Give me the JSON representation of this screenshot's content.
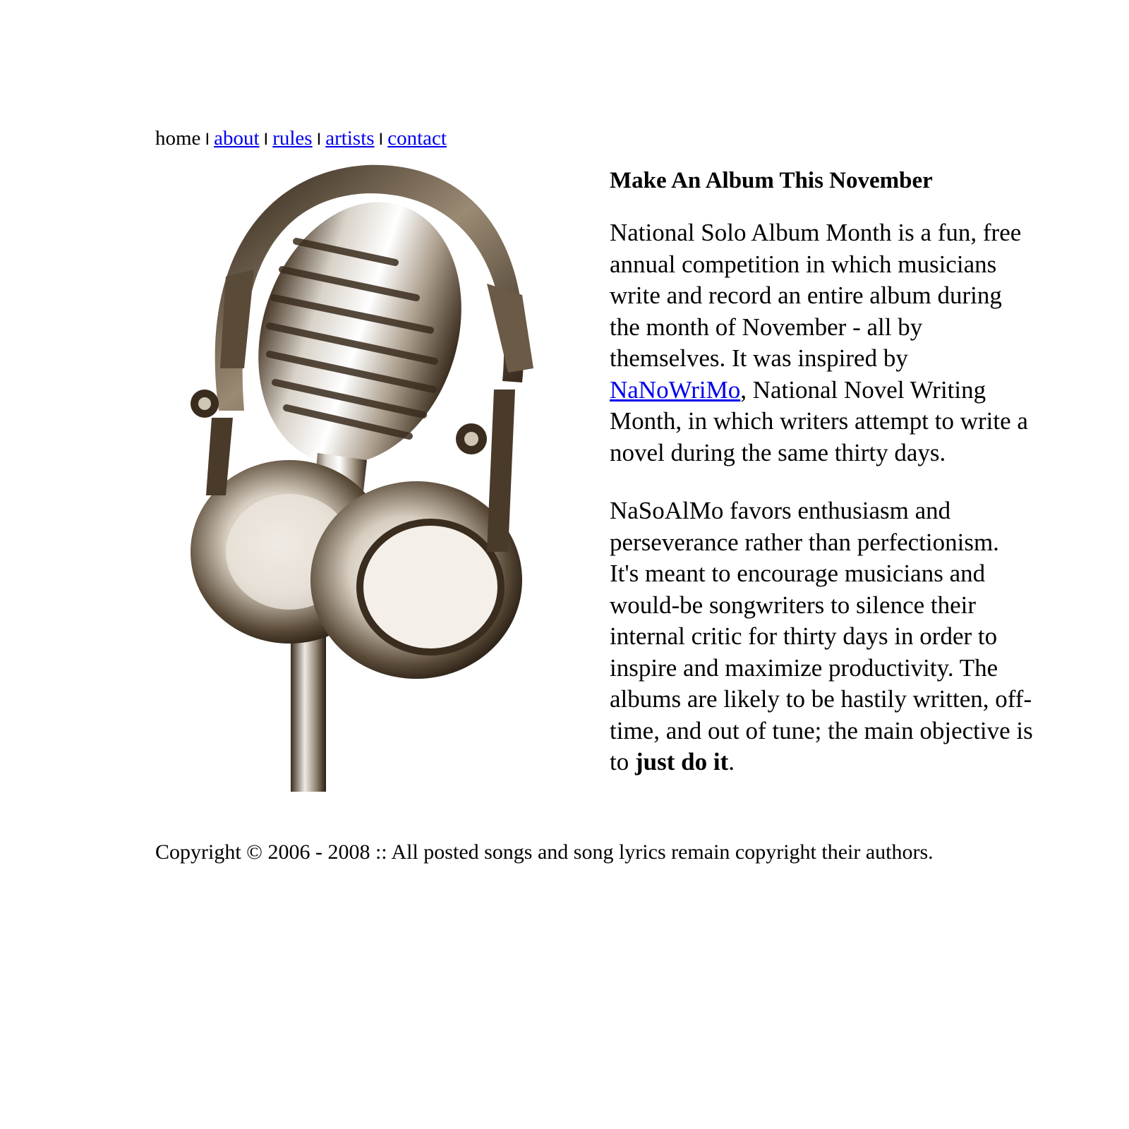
{
  "nav": {
    "home": "home",
    "separator": "I",
    "about": "about",
    "rules": "rules",
    "artists": "artists",
    "contact": "contact"
  },
  "main": {
    "heading": "Make An Album This November",
    "paragraph1": {
      "before_link": "National Solo Album Month is a fun, free annual competition in which musicians write and record an entire album during the month of November - all by themselves. It was inspired by ",
      "link": "NaNoWriMo",
      "after_link": ", National Novel Writing Month, in which writers attempt to write a novel during the same thirty days."
    },
    "paragraph2": {
      "text": "NaSoAlMo favors enthusiasm and perseverance rather than perfectionism. It's meant to encourage musicians and would-be songwriters to silence their internal critic for thirty days in order to inspire and maximize productivity. The albums are likely to be hastily written, off-time, and out of tune; the main objective is to ",
      "bold": "just do it",
      "end": "."
    }
  },
  "footer": {
    "text": "Copyright © 2006 - 2008 :: All posted songs and song lyrics remain copyright their authors."
  },
  "image": {
    "icon": "microphone-headphones-image"
  },
  "colors": {
    "link": "#0000ee",
    "text": "#000000",
    "background": "#ffffff"
  }
}
